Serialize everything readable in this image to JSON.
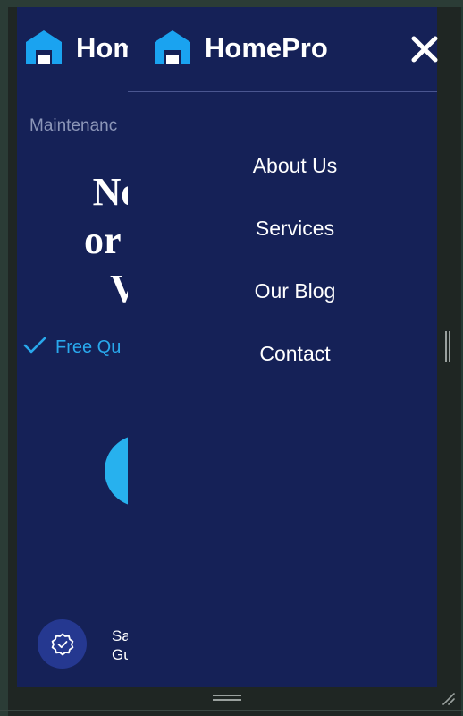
{
  "brand": {
    "name": "HomePro",
    "logo_icon": "house-logo-icon",
    "accent_color": "#1aa3f0",
    "navy_color": "#152157"
  },
  "background_page": {
    "logo_text": "HomePro",
    "eyebrow": "Maintenanc",
    "heading_lines": [
      "Nee",
      "or re",
      "V"
    ],
    "checklist_label": "Free Qu",
    "check_icon": "checkmark-icon",
    "badge_icon": "verified-badge-icon",
    "badge_text": "Sa\nGu"
  },
  "menu": {
    "close_icon": "close-icon",
    "items": [
      {
        "label": "About Us"
      },
      {
        "label": "Services"
      },
      {
        "label": "Our Blog"
      },
      {
        "label": "Contact"
      }
    ]
  },
  "window": {
    "scroll_grip_icon": "vertical-grip-icon",
    "bottom_grip_icon": "horizontal-grip-icon",
    "resize_icon": "resize-corner-icon"
  }
}
